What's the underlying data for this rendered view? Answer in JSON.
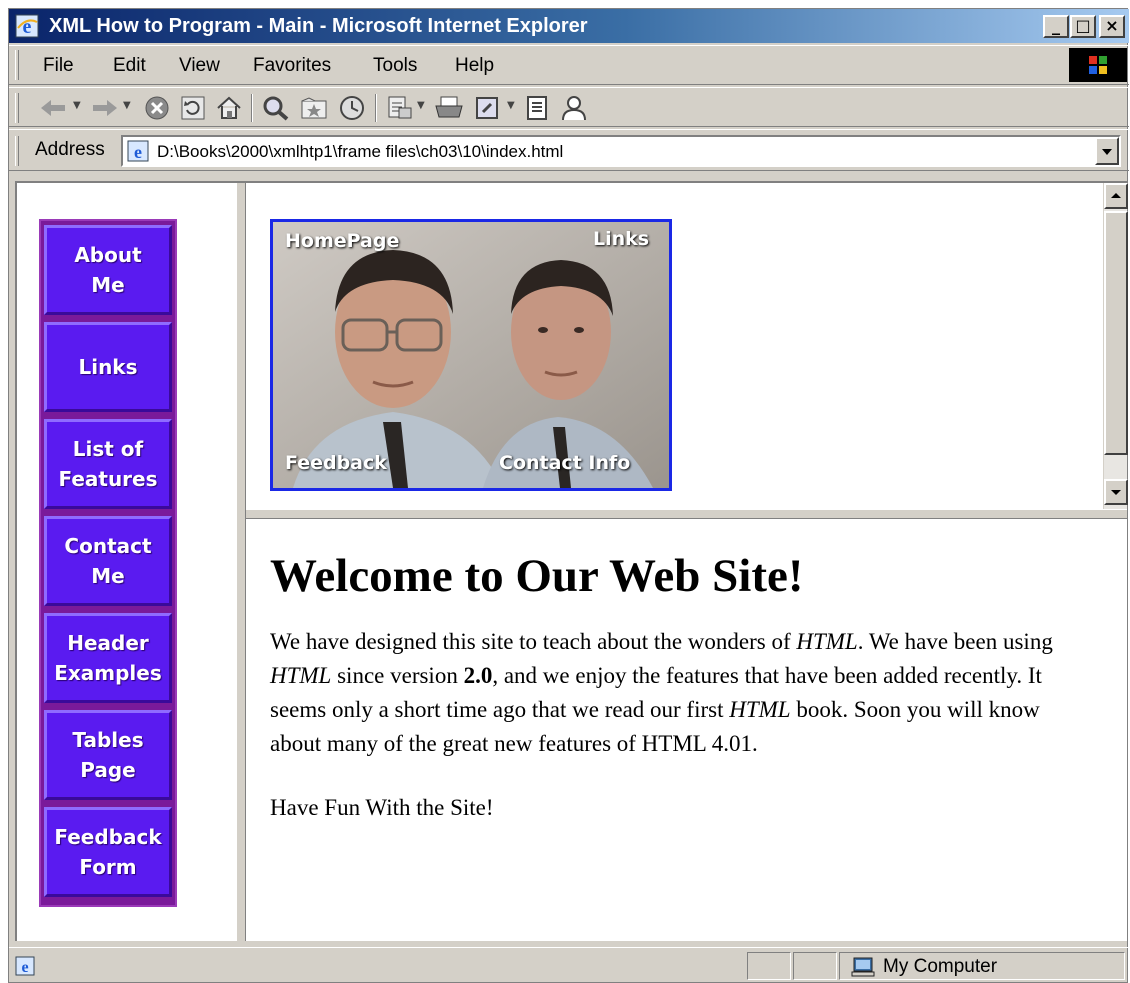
{
  "window": {
    "title": "XML How to Program - Main - Microsoft Internet Explorer",
    "minimize_label": "_",
    "maximize_label": "□",
    "close_label": "×"
  },
  "menu": {
    "items": [
      "File",
      "Edit",
      "View",
      "Favorites",
      "Tools",
      "Help"
    ]
  },
  "toolbar": {
    "icons": [
      "back-icon",
      "forward-icon",
      "stop-icon",
      "refresh-icon",
      "home-icon",
      "search-icon",
      "favorites-icon",
      "history-icon",
      "mail-icon",
      "print-icon",
      "edit-icon",
      "discuss-icon",
      "messenger-icon"
    ]
  },
  "address": {
    "label": "Address",
    "value": "D:\\Books\\2000\\xmlhtp1\\frame files\\ch03\\10\\index.html"
  },
  "nav": {
    "items": [
      {
        "line1": "About",
        "line2": "Me"
      },
      {
        "line1": "Links",
        "line2": ""
      },
      {
        "line1": "List of",
        "line2": "Features"
      },
      {
        "line1": "Contact",
        "line2": "Me"
      },
      {
        "line1": "Header",
        "line2": "Examples"
      },
      {
        "line1": "Tables",
        "line2": "Page"
      },
      {
        "line1": "Feedback",
        "line2": "Form"
      }
    ]
  },
  "imagemap": {
    "homepage": "HomePage",
    "links": "Links",
    "feedback": "Feedback",
    "contact": "Contact Info"
  },
  "main": {
    "heading": "Welcome to Our Web Site!",
    "p_1": "We have designed this site to teach about the wonders of ",
    "p_html1": "HTML",
    "p_2": ". We have been using ",
    "p_html2": "HTML",
    "p_3": " since version ",
    "p_version": "2.0",
    "p_4": ", and we enjoy the features that have been added recently. It seems only a short time ago that we read our first ",
    "p_html3": "HTML",
    "p_5": " book. Soon you will know about many of the great new features of HTML 4.01.",
    "fun": "Have Fun With the Site!"
  },
  "status": {
    "zone": "My Computer"
  },
  "colors": {
    "nav_button": "#5a1bf0",
    "nav_border": "#7a1a9a",
    "image_border": "#1a28e6",
    "titlebar": "#0a246a"
  }
}
